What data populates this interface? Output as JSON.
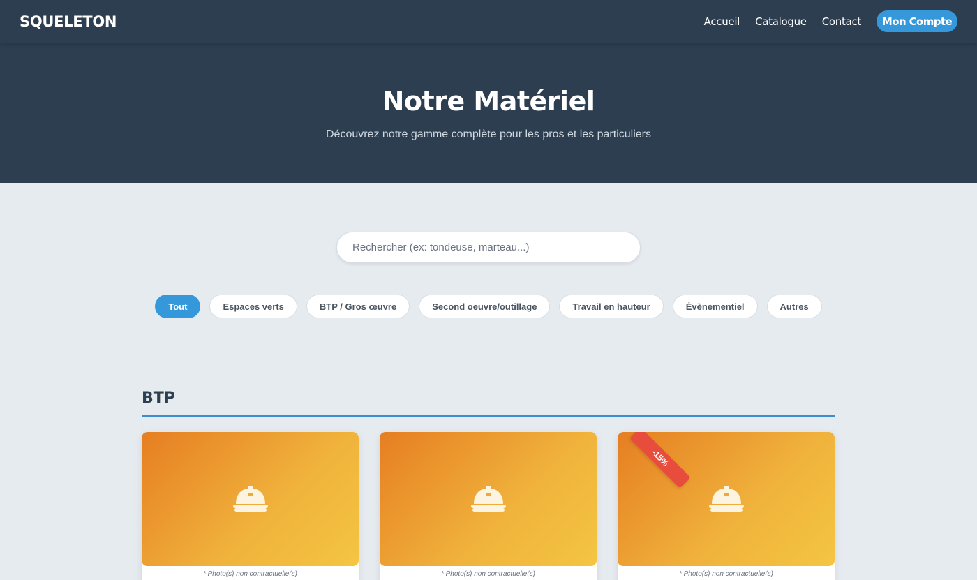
{
  "header": {
    "logo": "SQUELETON",
    "nav": [
      "Accueil",
      "Catalogue",
      "Contact"
    ],
    "account_button": "Mon Compte"
  },
  "hero": {
    "title": "Notre Matériel",
    "subtitle": "Découvrez notre gamme complète pour les pros et les particuliers"
  },
  "search": {
    "placeholder": "Rechercher (ex: tondeuse, marteau...)",
    "value": ""
  },
  "filters": {
    "active": "Tout",
    "items": [
      "Tout",
      "Espaces verts",
      "BTP / Gros œuvre",
      "Second oeuvre/outillage",
      "Travail en hauteur",
      "Évènementiel",
      "Autres"
    ]
  },
  "section": {
    "title": "BTP"
  },
  "cards": [
    {
      "icon": "hard-hat-icon",
      "caption": "* Photo(s) non contractuelle(s)",
      "badge": ""
    },
    {
      "icon": "hard-hat-icon",
      "caption": "* Photo(s) non contractuelle(s)",
      "badge": ""
    },
    {
      "icon": "hard-hat-icon",
      "caption": "* Photo(s) non contractuelle(s)",
      "badge": "-15%"
    }
  ],
  "colors": {
    "header_bg": "#2c3e50",
    "accent": "#3498db",
    "page_bg": "#e6ebf0",
    "discount": "#e74c3c",
    "card_gradient_start": "#e67e22",
    "card_gradient_end": "#f4c542"
  }
}
